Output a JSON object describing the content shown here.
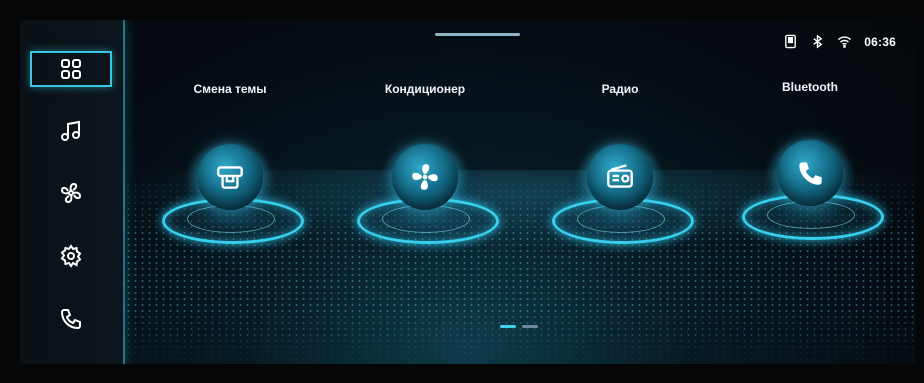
{
  "status_bar": {
    "icons": [
      "usb-icon",
      "bluetooth-icon",
      "wifi-icon"
    ],
    "time": "06:36"
  },
  "sidebar": {
    "items": [
      {
        "icon": "apps-grid-icon",
        "active": true
      },
      {
        "icon": "music-icon",
        "active": false
      },
      {
        "icon": "fan-icon",
        "active": false
      },
      {
        "icon": "settings-gear-icon",
        "active": false
      },
      {
        "icon": "phone-icon",
        "active": false
      }
    ]
  },
  "tiles": [
    {
      "label": "Смена темы",
      "icon": "theme-shirt-icon"
    },
    {
      "label": "Кондиционер",
      "icon": "fan-icon"
    },
    {
      "label": "Радио",
      "icon": "radio-icon"
    },
    {
      "label": "Bluetooth",
      "icon": "phone-icon"
    }
  ],
  "pager": {
    "pages": 2,
    "current": 1
  },
  "colors": {
    "accent": "#39c7e4",
    "background": "#050c12",
    "text": "#f2f6f8"
  }
}
